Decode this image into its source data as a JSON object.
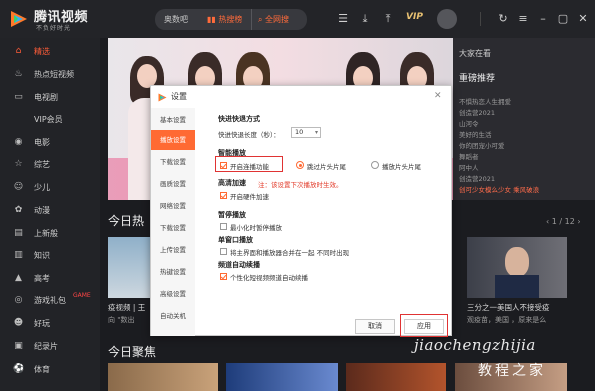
{
  "app": {
    "logo_text": "腾讯视频",
    "logo_sub": "不负好时光"
  },
  "topbar": {
    "search_value": "奥数吧",
    "hot_search": "热搜榜",
    "global_search": "全网搜",
    "vip_label": "VIP"
  },
  "sidebar": {
    "items": [
      {
        "label": "精选",
        "icon": "home-icon",
        "active": true
      },
      {
        "label": "热点短视频",
        "icon": "fire-icon"
      },
      {
        "label": "电视剧",
        "icon": "tv-icon"
      },
      {
        "label": "VIP会员",
        "icon": ""
      },
      {
        "label": "电影",
        "icon": "film-icon"
      },
      {
        "label": "综艺",
        "icon": "star-icon"
      },
      {
        "label": "少儿",
        "icon": "kid-icon"
      },
      {
        "label": "动漫",
        "icon": "anime-icon"
      },
      {
        "label": "上新般",
        "icon": "new-icon"
      },
      {
        "label": "知识",
        "icon": "book-icon"
      },
      {
        "label": "高考",
        "icon": "cap-icon"
      },
      {
        "label": "游戏礼包",
        "icon": "gamepad-icon",
        "badge": "GAME"
      },
      {
        "label": "好玩",
        "icon": "smile-icon"
      },
      {
        "label": "纪录片",
        "icon": "doc-icon"
      },
      {
        "label": "体育",
        "icon": "ball-icon"
      }
    ]
  },
  "right_panel": {
    "title": "大家在看",
    "hot_title": "重磅推荐",
    "items": [
      "不惧热恋人生拥爱",
      "创造营2021",
      "山河令",
      "美好的生活",
      "你的团宠小可爱",
      "舞蹈者",
      "阿中人",
      "创造营2021",
      "创可少女模么少女 乘风破浪"
    ]
  },
  "main": {
    "today_title": "今日热",
    "page_indicator": "1 / 12",
    "thumb1_cap": "疫视频 | 王",
    "thumb1_sub": "向 \"数出",
    "thumb2_cap": "三分之一美国人不接受疫",
    "thumb2_sub": "观疫苗，美国 ，原来是么",
    "focus_title": "今日聚焦"
  },
  "dialog": {
    "title": "设置",
    "nav": [
      "基本设置",
      "播放设置",
      "下载设置",
      "画质设置",
      "网络设置",
      "下载设置",
      "上传设置",
      "热键设置",
      "高级设置",
      "自动关机"
    ],
    "active_nav": 1,
    "fast_title": "快进快退方式",
    "fast_label": "快进快退长度（秒）：",
    "fast_value": "10",
    "smart_title": "智能播放",
    "opt_continuous": "开启连播功能",
    "opt_skip_head": "跳过片头片尾",
    "opt_play_head": "播放片头片尾",
    "hw_title": "高清加速",
    "hw_warn": "注：该设置下次播放时生效。",
    "hw_opt": "开启硬件加速",
    "mini_title": "暂停播放",
    "mini_opt": "最小化时暂停播放",
    "split_title": "单窗口播放",
    "split_opt": "将主界面和播放器合并在一起 不同时出现",
    "auto_title": "频道自动续播",
    "auto_opt": "个性化短视频频道自动续播",
    "cancel": "取消",
    "apply": "应用"
  },
  "watermark": {
    "line1": "jiaochengzhijia",
    "line2": "教程之家"
  }
}
